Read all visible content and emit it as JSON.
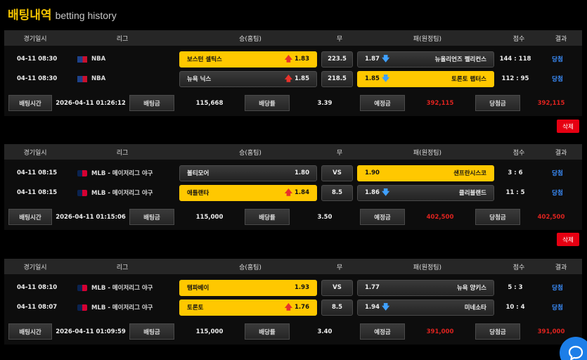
{
  "page": {
    "title_ko": "배팅내역",
    "title_en": "betting history"
  },
  "headers": {
    "date": "경기일시",
    "league": "리그",
    "home": "승(홈팀)",
    "draw": "무",
    "away": "패(원정팀)",
    "score": "점수",
    "result": "결과"
  },
  "labels": {
    "bet_time": "배팅시간",
    "bet_amount": "배팅금",
    "odds": "배당률",
    "expected": "예정금",
    "won": "당첨금",
    "delete": "삭제"
  },
  "bets": [
    {
      "games": [
        {
          "date": "04-11 08:30",
          "league": "NBA",
          "home": "보스턴 셀틱스",
          "home_odds": "1.83",
          "draw": "223.5",
          "away": "뉴올리언즈 펠리컨스",
          "away_odds": "1.87",
          "score": "144 : 118",
          "result": "당첨"
        },
        {
          "date": "04-11 08:30",
          "league": "NBA",
          "home": "뉴욕 닉스",
          "home_odds": "1.85",
          "draw": "218.5",
          "away": "토론토 랩터스",
          "away_odds": "1.85",
          "score": "112 : 95",
          "result": "당첨"
        }
      ],
      "bet_time": "2026-04-11 01:26:12",
      "bet_amount": "115,668",
      "odds": "3.39",
      "expected": "392,115",
      "won": "392,115"
    },
    {
      "games": [
        {
          "date": "04-11 08:15",
          "league": "MLB - 메이저리그 야구",
          "home": "볼티모어",
          "home_odds": "1.80",
          "draw": "VS",
          "away": "샌프란시스코",
          "away_odds": "1.90",
          "score": "3 : 6",
          "result": "당첨"
        },
        {
          "date": "04-11 08:15",
          "league": "MLB - 메이저리그 야구",
          "home": "애틀랜타",
          "home_odds": "1.84",
          "draw": "8.5",
          "away": "클리블랜드",
          "away_odds": "1.86",
          "score": "11 : 5",
          "result": "당첨"
        }
      ],
      "bet_time": "2026-04-11 01:15:06",
      "bet_amount": "115,000",
      "odds": "3.50",
      "expected": "402,500",
      "won": "402,500"
    },
    {
      "games": [
        {
          "date": "04-11 08:10",
          "league": "MLB - 메이저리그 야구",
          "home": "탬파베이",
          "home_odds": "1.93",
          "draw": "VS",
          "away": "뉴욕 양키스",
          "away_odds": "1.77",
          "score": "5 : 3",
          "result": "당첨"
        },
        {
          "date": "04-11 08:07",
          "league": "MLB - 메이저리그 야구",
          "home": "토론토",
          "home_odds": "1.76",
          "draw": "8.5",
          "away": "미네소타",
          "away_odds": "1.94",
          "score": "10 : 4",
          "result": "당첨"
        }
      ],
      "bet_time": "2026-04-11 01:09:59",
      "bet_amount": "115,000",
      "odds": "3.40",
      "expected": "391,000",
      "won": "391,000"
    }
  ]
}
